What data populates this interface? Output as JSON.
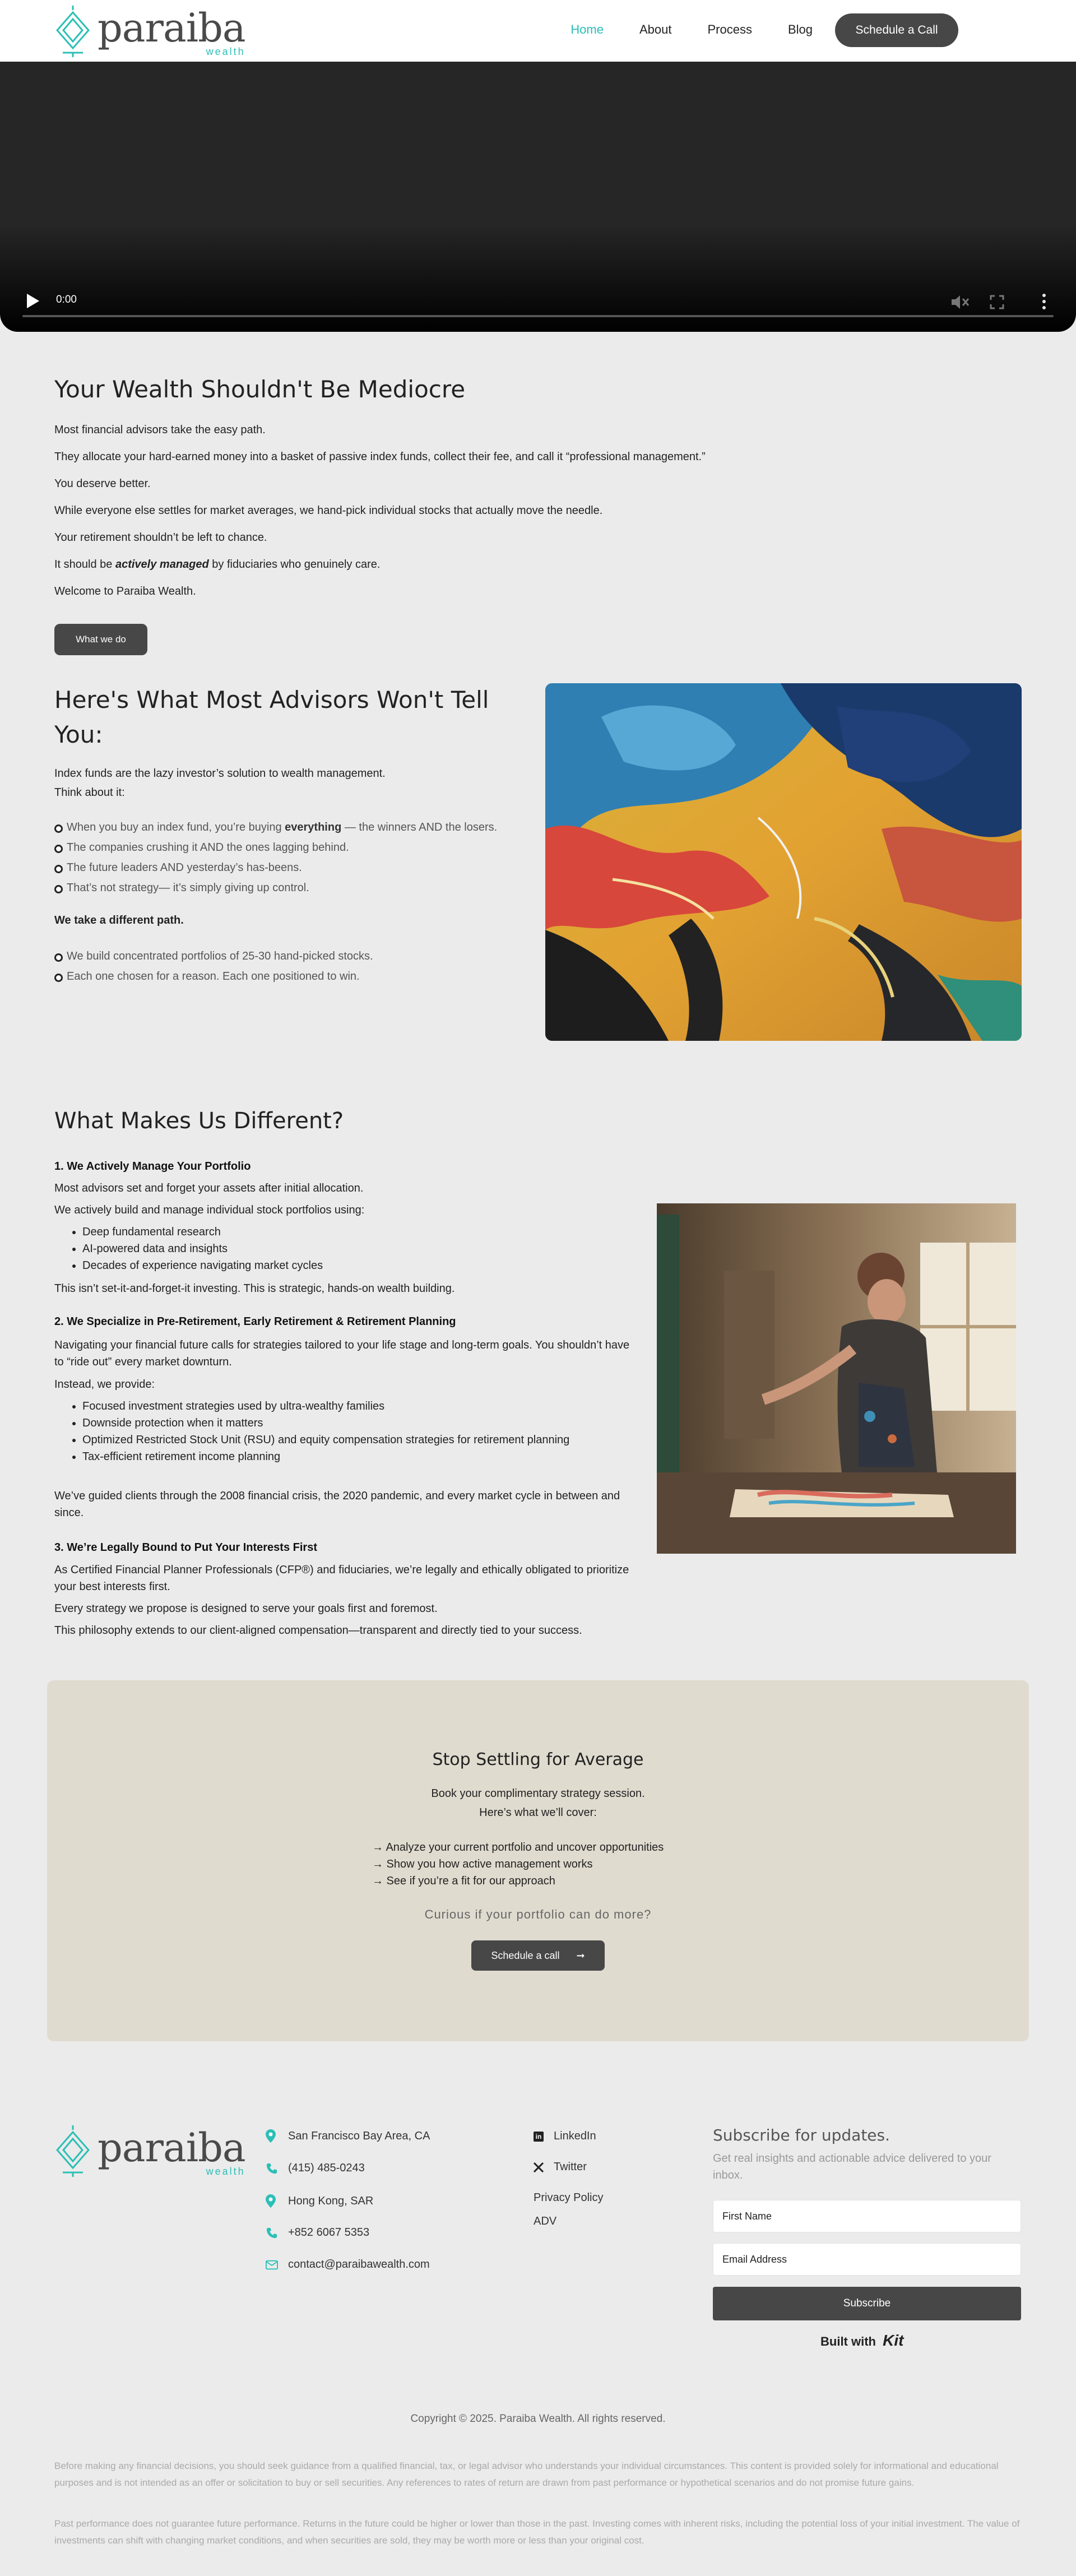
{
  "header": {
    "logo_word": "paraiba",
    "logo_sub": "wealth",
    "nav": [
      "Home",
      "About",
      "Process",
      "Blog"
    ],
    "cta": "Schedule a Call"
  },
  "video": {
    "time": "0:00"
  },
  "intro": {
    "title": "Your Wealth Shouldn't Be Mediocre",
    "p1": "Most financial advisors take the easy path.",
    "p2": "They allocate your hard-earned money into a basket of passive index funds, collect their fee, and call it “professional management.”",
    "p3": "You deserve better.",
    "p4": "While everyone else settles for market averages, we hand-pick individual stocks that actually move the needle.",
    "p5": "Your retirement shouldn’t be left to chance.",
    "p6_pre": "It should be ",
    "p6_em": "actively managed",
    "p6_post": " by fiduciaries who genuinely care.",
    "p7": "Welcome to Paraiba Wealth.",
    "button": "What we do"
  },
  "advisors": {
    "title": "Here's What Most Advisors Won't Tell You:",
    "lead1": "Index funds are the lazy investor’s solution to wealth management.",
    "lead2": "Think about it:",
    "b1_pre": "When you buy an index fund, you’re buying ",
    "b1_strong": "everything",
    "b1_post": " — the winners AND the losers.",
    "b2": "The companies crushing it AND the ones lagging behind.",
    "b3": "The future leaders AND yesterday’s has-beens.",
    "b4": "That’s not strategy— it’s simply giving up control.",
    "path": "We take a different path.",
    "b5": "We build concentrated portfolios of 25-30 hand-picked stocks.",
    "b6": "Each one chosen for a reason. Each one positioned to win."
  },
  "different": {
    "title": "What Makes Us Different?",
    "s1": "1. We Actively Manage Your Portfolio",
    "s1_p1": "Most advisors set and forget your assets after initial allocation.",
    "s1_p2": "We actively build and manage individual stock portfolios using:",
    "s1_list": [
      "Deep fundamental research",
      "AI-powered data and insights",
      "Decades of experience navigating market cycles"
    ],
    "s1_p3": "This isn’t set-it-and-forget-it investing. This is strategic, hands-on wealth building.",
    "s2": "2. We Specialize in Pre-Retirement, Early Retirement & Retirement Planning",
    "s2_p1": "Navigating your financial future calls for strategies tailored to your life stage and long-term goals. You shouldn’t have to “ride out” every market downturn.",
    "s2_p2": "Instead, we provide:",
    "s2_list": [
      "Focused investment strategies used by ultra-wealthy families",
      "Downside protection when it matters",
      "Optimized Restricted Stock Unit (RSU) and equity compensation strategies for retirement planning",
      "Tax-efficient retirement income planning"
    ],
    "s2_p3": "We’ve guided clients through the 2008 financial crisis, the 2020 pandemic, and every market cycle in between and since.",
    "s3": "3. We’re Legally Bound to Put Your Interests First",
    "s3_p1": "As Certified Financial Planner Professionals (CFP®) and fiduciaries, we’re legally and ethically obligated to prioritize your best interests first.",
    "s3_p2": "Every strategy we propose is designed to serve your goals first and foremost.",
    "s3_p3": "This philosophy extends to our client-aligned compensation—transparent and directly tied to your success."
  },
  "cta": {
    "title": "Stop Settling for Average",
    "l1": "Book your complimentary strategy session.",
    "l2": "Here’s what we’ll cover:",
    "items": [
      "→ Analyze your current portfolio and uncover opportunities",
      "→ Show you how active management works",
      "→ See if you’re a fit for our approach"
    ],
    "question": "Curious if your portfolio can do more?",
    "button": "Schedule a call",
    "button_arrow": "➞"
  },
  "footer": {
    "contacts": [
      {
        "icon": "location-pin-icon",
        "text": "San Francisco Bay Area, CA"
      },
      {
        "icon": "phone-icon",
        "text": "(415) 485-0243"
      },
      {
        "icon": "location-pin-icon",
        "text": "Hong Kong, SAR"
      },
      {
        "icon": "phone-icon",
        "text": "+852 6067 5353"
      },
      {
        "icon": "email-icon",
        "text": "contact@paraibawealth.com"
      }
    ],
    "links": {
      "linkedin": "LinkedIn",
      "twitter": "Twitter",
      "privacy": "Privacy Policy",
      "adv": "ADV"
    },
    "subscribe_title": "Subscribe for updates.",
    "subscribe_desc": "Get real insights and actionable advice delivered to your inbox.",
    "first_name": "First Name",
    "email": "Email Address",
    "subscribe_btn": "Subscribe",
    "built_with": "Built with",
    "built_brand": "Kit",
    "copyright": "Copyright © 2025. Paraiba Wealth. All rights reserved.",
    "disclaimer1": "Before making any financial decisions, you should seek guidance from a qualified financial, tax, or legal advisor who understands your individual circumstances. This content is provided solely for informational and educational purposes and is not intended as an offer or solicitation to buy or sell securities. Any references to rates of return are drawn from past performance or hypothetical scenarios and do not promise future gains.",
    "disclaimer2": "Past performance does not guarantee future performance. Returns in the future could be higher or lower than those in the past. Investing comes with inherent risks, including the potential loss of your initial investment. The value of investments can shift with changing market conditions, and when securities are sold, they may be worth more or less than your original cost."
  },
  "colors": {
    "accent": "#2bbfb6",
    "dark_button": "#474747",
    "cta_bg": "#e0dbcf",
    "page_bg": "#ebebeb"
  }
}
